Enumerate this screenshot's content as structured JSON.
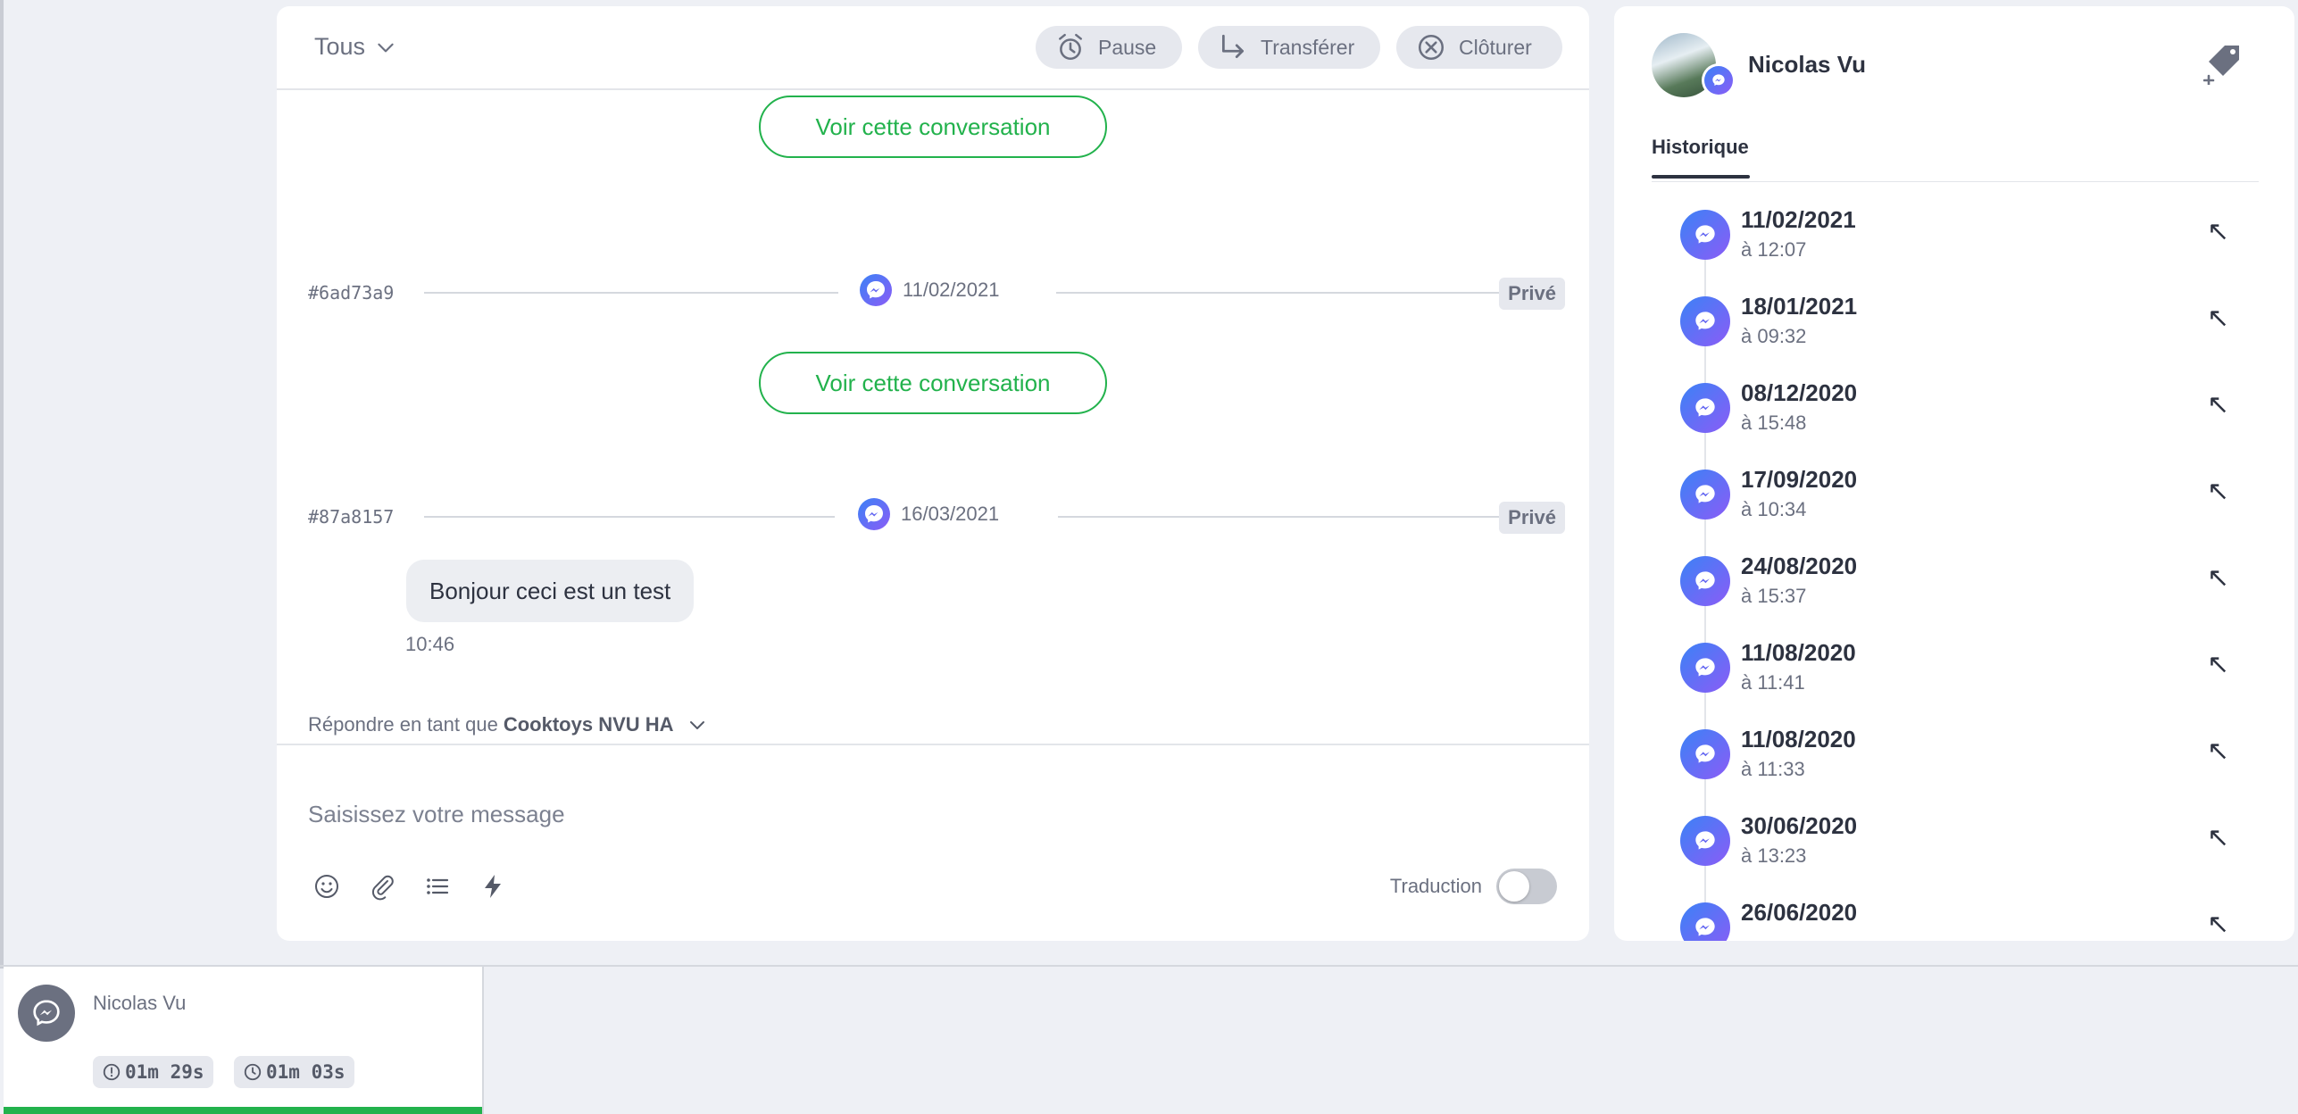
{
  "colors": {
    "accent_green": "#22b24c",
    "messenger_gradient_start": "#3b82f6",
    "messenger_gradient_end": "#8b5cf6",
    "muted_text": "#6b7080"
  },
  "header": {
    "filter_label": "Tous",
    "pause_label": "Pause",
    "transfer_label": "Transférer",
    "close_label": "Clôturer"
  },
  "conversation": {
    "view_conversation_label": "Voir cette conversation",
    "separators": [
      {
        "hash": "#6ad73a9",
        "date": "11/02/2021",
        "visibility": "Privé",
        "channel_icon": "messenger-icon"
      },
      {
        "hash": "#87a8157",
        "date": "16/03/2021",
        "visibility": "Privé",
        "channel_icon": "messenger-icon"
      }
    ],
    "message": {
      "text": "Bonjour ceci est un test",
      "time": "10:46"
    }
  },
  "composer": {
    "reply_as_prefix": "Répondre en tant que",
    "reply_as_name": "Cooktoys NVU HA",
    "placeholder": "Saisissez votre message",
    "translation_label": "Traduction",
    "translation_enabled": false,
    "tools": [
      "emoji-icon",
      "attachment-icon",
      "list-icon",
      "lightning-icon"
    ]
  },
  "contact": {
    "name": "Nicolas Vu",
    "tab_label": "Historique",
    "history": [
      {
        "date": "11/02/2021",
        "time": "à 12:07"
      },
      {
        "date": "18/01/2021",
        "time": "à 09:32"
      },
      {
        "date": "08/12/2020",
        "time": "à 15:48"
      },
      {
        "date": "17/09/2020",
        "time": "à 10:34"
      },
      {
        "date": "24/08/2020",
        "time": "à 15:37"
      },
      {
        "date": "11/08/2020",
        "time": "à 11:41"
      },
      {
        "date": "11/08/2020",
        "time": "à 11:33"
      },
      {
        "date": "30/06/2020",
        "time": "à 13:23"
      },
      {
        "date": "26/06/2020",
        "time": ""
      }
    ],
    "open_arrow_glyph": "↖"
  },
  "active_conversation": {
    "name": "Nicolas Vu",
    "timer_1": "01m 29s",
    "timer_2": "01m 03s"
  }
}
